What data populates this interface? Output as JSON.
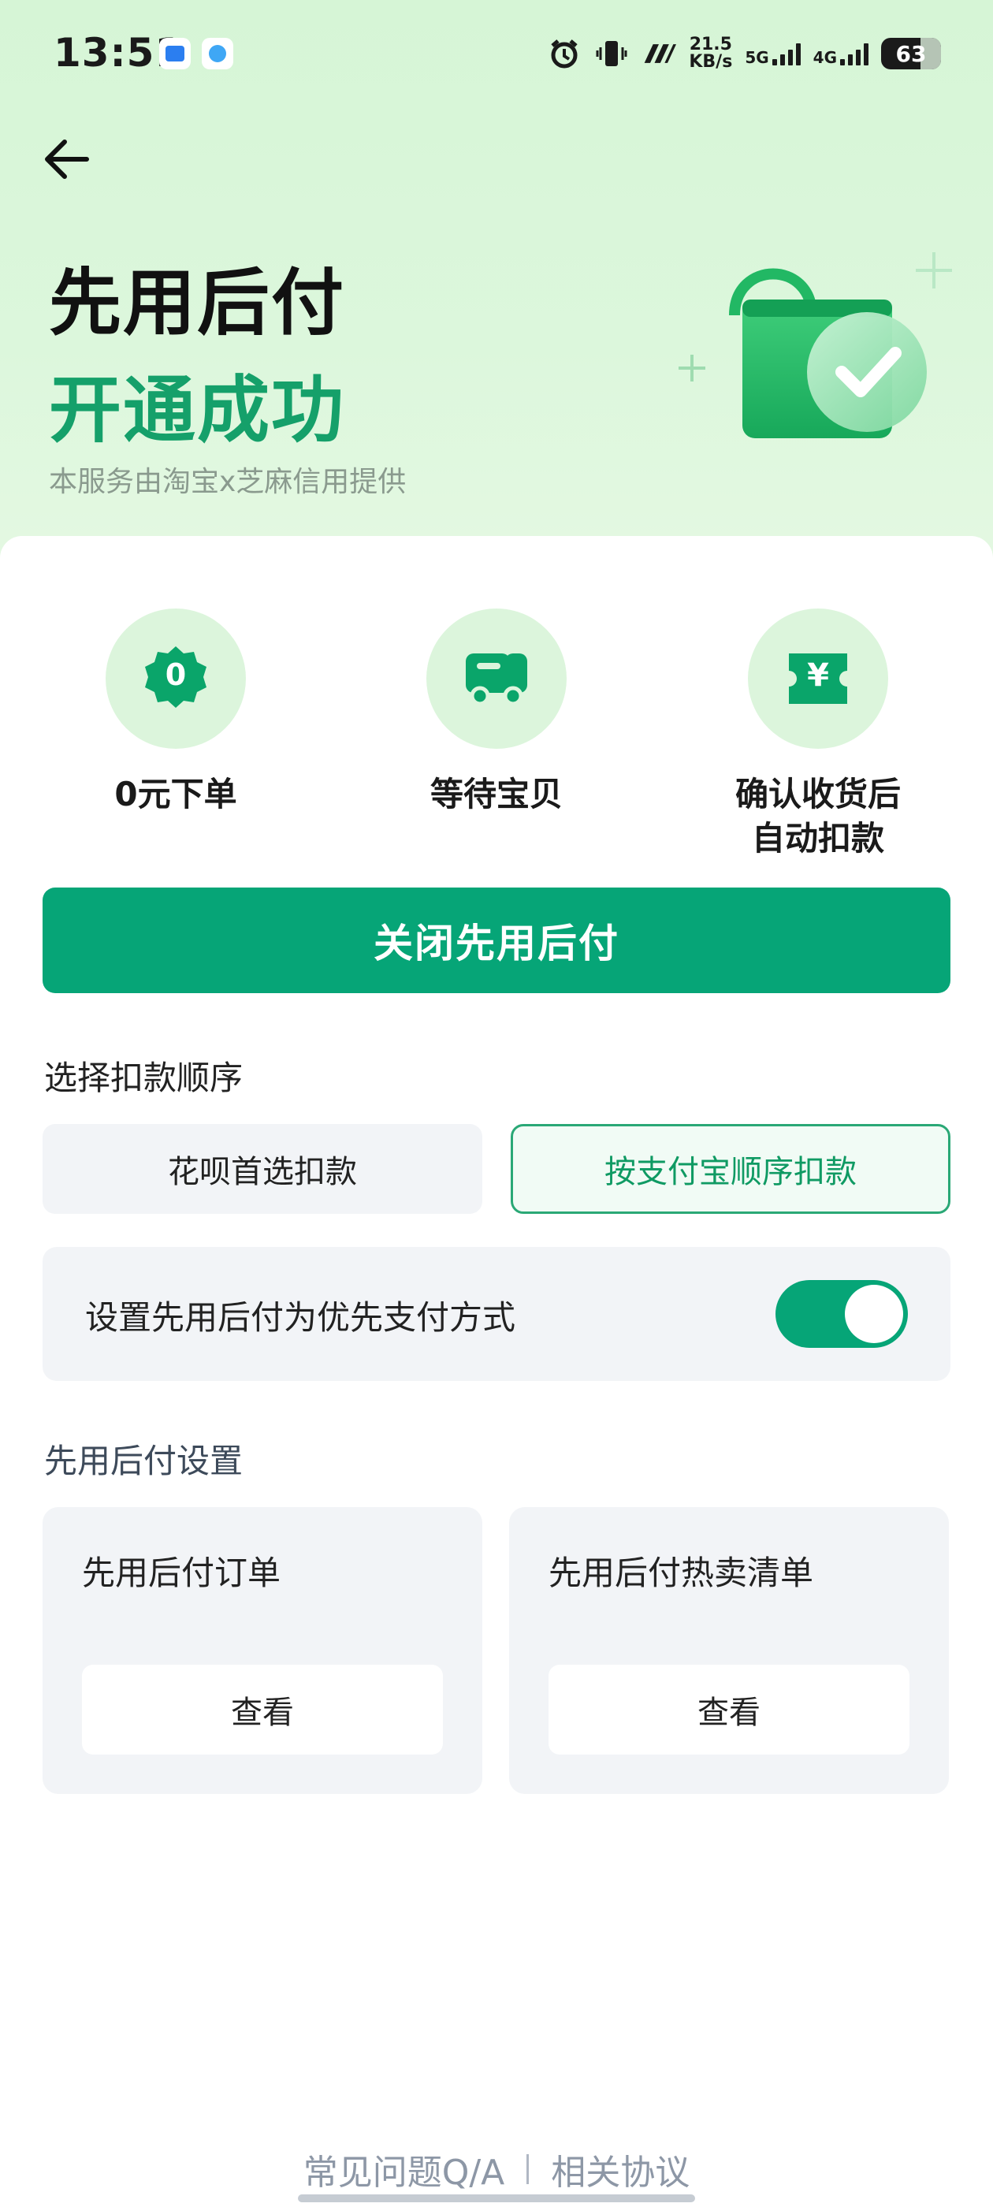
{
  "status_bar": {
    "time": "13:51",
    "speed_value": "21.5",
    "speed_unit": "KB/s",
    "net1": "5G",
    "net2": "4G",
    "battery": "63"
  },
  "header": {
    "title_line1": "先用后付",
    "title_line2": "开通成功",
    "provider": "本服务由淘宝x芝麻信用提供"
  },
  "features": [
    {
      "label": "0元下单",
      "icon": "zero-badge-icon",
      "badge": "0"
    },
    {
      "label": "等待宝贝",
      "icon": "delivery-truck-icon"
    },
    {
      "label": "确认收货后\n自动扣款",
      "icon": "yuan-ticket-icon",
      "badge": "¥"
    }
  ],
  "close_button": "关闭先用后付",
  "deduction": {
    "title": "选择扣款顺序",
    "options": [
      "花呗首选扣款",
      "按支付宝顺序扣款"
    ],
    "selected": "按支付宝顺序扣款"
  },
  "priority": {
    "label": "设置先用后付为优先支付方式",
    "enabled": true
  },
  "settings": {
    "title": "先用后付设置",
    "cards": [
      {
        "title": "先用后付订单",
        "button": "查看"
      },
      {
        "title": "先用后付热卖清单",
        "button": "查看"
      }
    ]
  },
  "footer": {
    "faq": "常见问题Q/A",
    "agreement": "相关协议"
  },
  "colors": {
    "accent": "#06a577",
    "hero_bg": "#d6f5d6",
    "title_green": "#15a06a"
  }
}
